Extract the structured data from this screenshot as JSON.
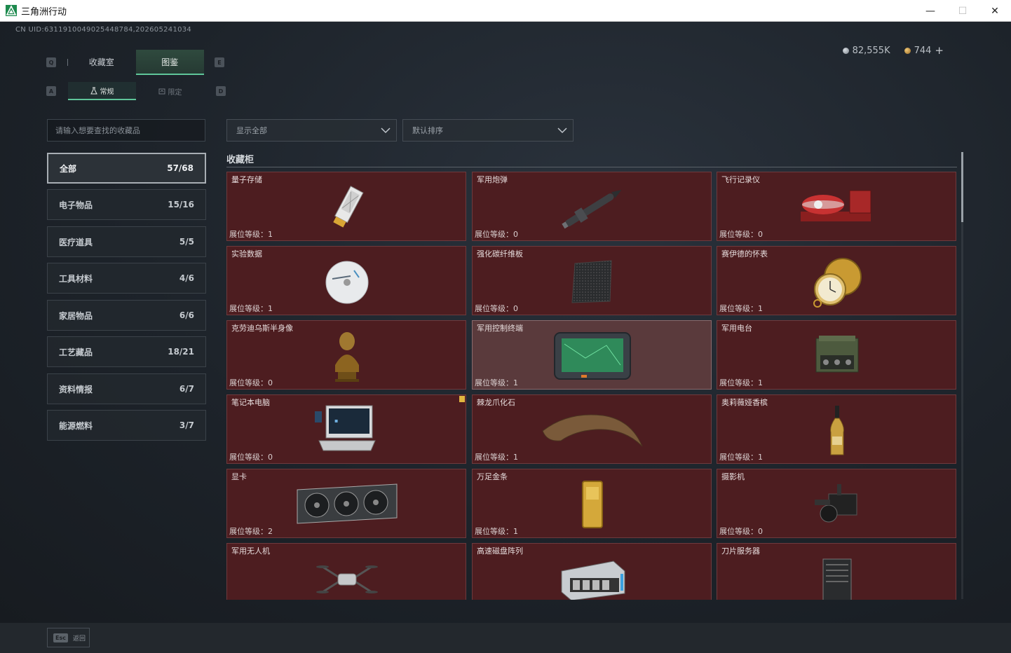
{
  "window": {
    "title": "三角洲行动",
    "controls": [
      "—",
      "☐",
      "✕"
    ]
  },
  "header": {
    "uid": "CN UID:6311910049025448784,202605241034",
    "currency": [
      {
        "icon": "silver-coin-icon",
        "value": "82,555K"
      },
      {
        "icon": "gold-coin-icon",
        "value": "744",
        "add": "+"
      }
    ]
  },
  "keys": {
    "q": "Q",
    "e": "E",
    "a": "A",
    "d": "D"
  },
  "tabs": [
    {
      "label": "收藏室",
      "active": false
    },
    {
      "label": "图鉴",
      "active": true
    }
  ],
  "subtabs": [
    {
      "label": "常规",
      "active": true
    },
    {
      "label": "限定",
      "active": false
    }
  ],
  "search": {
    "placeholder": "请输入想要查找的收藏品"
  },
  "categories": [
    {
      "label": "全部",
      "count": "57/68",
      "active": true
    },
    {
      "label": "电子物品",
      "count": "15/16"
    },
    {
      "label": "医疗道具",
      "count": "5/5"
    },
    {
      "label": "工具材料",
      "count": "4/6"
    },
    {
      "label": "家居物品",
      "count": "6/6"
    },
    {
      "label": "工艺藏品",
      "count": "18/21"
    },
    {
      "label": "资料情报",
      "count": "6/7"
    },
    {
      "label": "能源燃料",
      "count": "3/7"
    }
  ],
  "filters": {
    "display": "显示全部",
    "sort": "默认排序"
  },
  "section": {
    "title": "收藏柜"
  },
  "items": [
    {
      "name": "量子存储",
      "level": "展位等级：1",
      "icon": "quantum-storage-icon"
    },
    {
      "name": "军用炮弹",
      "level": "展位等级：0",
      "icon": "artillery-shell-icon"
    },
    {
      "name": "飞行记录仪",
      "level": "展位等级：0",
      "icon": "flight-recorder-icon"
    },
    {
      "name": "实验数据",
      "level": "展位等级：1",
      "icon": "data-disc-icon"
    },
    {
      "name": "强化碳纤维板",
      "level": "展位等级：0",
      "icon": "carbon-plate-icon"
    },
    {
      "name": "赛伊德的怀表",
      "level": "展位等级：1",
      "icon": "pocket-watch-icon"
    },
    {
      "name": "克劳迪乌斯半身像",
      "level": "展位等级：0",
      "icon": "bust-icon"
    },
    {
      "name": "军用控制终端",
      "level": "展位等级：1",
      "icon": "control-terminal-icon",
      "highlight": true
    },
    {
      "name": "军用电台",
      "level": "展位等级：1",
      "icon": "military-radio-icon"
    },
    {
      "name": "笔记本电脑",
      "level": "展位等级：0",
      "icon": "laptop-icon",
      "badge": true
    },
    {
      "name": "棘龙爪化石",
      "level": "展位等级：1",
      "icon": "claw-fossil-icon"
    },
    {
      "name": "奥莉薇娅香槟",
      "level": "展位等级：1",
      "icon": "champagne-icon"
    },
    {
      "name": "显卡",
      "level": "展位等级：2",
      "icon": "graphics-card-icon"
    },
    {
      "name": "万足金条",
      "level": "展位等级：1",
      "icon": "gold-bar-icon"
    },
    {
      "name": "摄影机",
      "level": "展位等级：0",
      "icon": "video-camera-icon"
    },
    {
      "name": "军用无人机",
      "level": "",
      "icon": "drone-icon"
    },
    {
      "name": "高速磁盘阵列",
      "level": "",
      "icon": "disk-array-icon"
    },
    {
      "name": "刀片服务器",
      "level": "",
      "icon": "blade-server-icon"
    }
  ],
  "footer": {
    "esc_key": "Esc",
    "back_label": "返回"
  }
}
